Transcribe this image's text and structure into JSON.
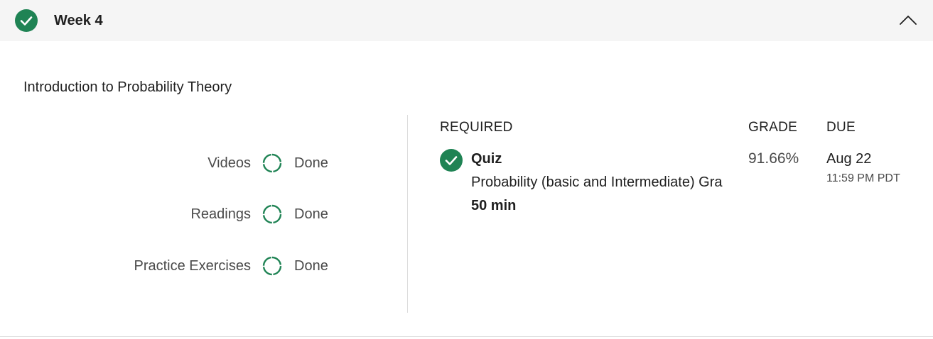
{
  "week": {
    "title": "Week 4",
    "completed": true
  },
  "section": {
    "title": "Introduction to Probability Theory"
  },
  "progress": [
    {
      "label": "Videos",
      "status": "Done"
    },
    {
      "label": "Readings",
      "status": "Done"
    },
    {
      "label": "Practice Exercises",
      "status": "Done"
    }
  ],
  "assignments": {
    "headers": {
      "required": "REQUIRED",
      "grade": "GRADE",
      "due": "DUE"
    },
    "items": [
      {
        "type": "Quiz",
        "name": "Probability (basic and Intermediate) Gra",
        "duration": "50 min",
        "grade": "91.66%",
        "due_date": "Aug 22",
        "due_time": "11:59 PM PDT",
        "completed": true
      }
    ]
  },
  "colors": {
    "accent_green": "#1f8354",
    "header_bg": "#f5f5f5"
  },
  "icons": {
    "week_status": "check-circle-icon",
    "collapse": "chevron-up-icon",
    "progress": "progress-ring-icon",
    "quiz_status": "check-circle-icon"
  }
}
